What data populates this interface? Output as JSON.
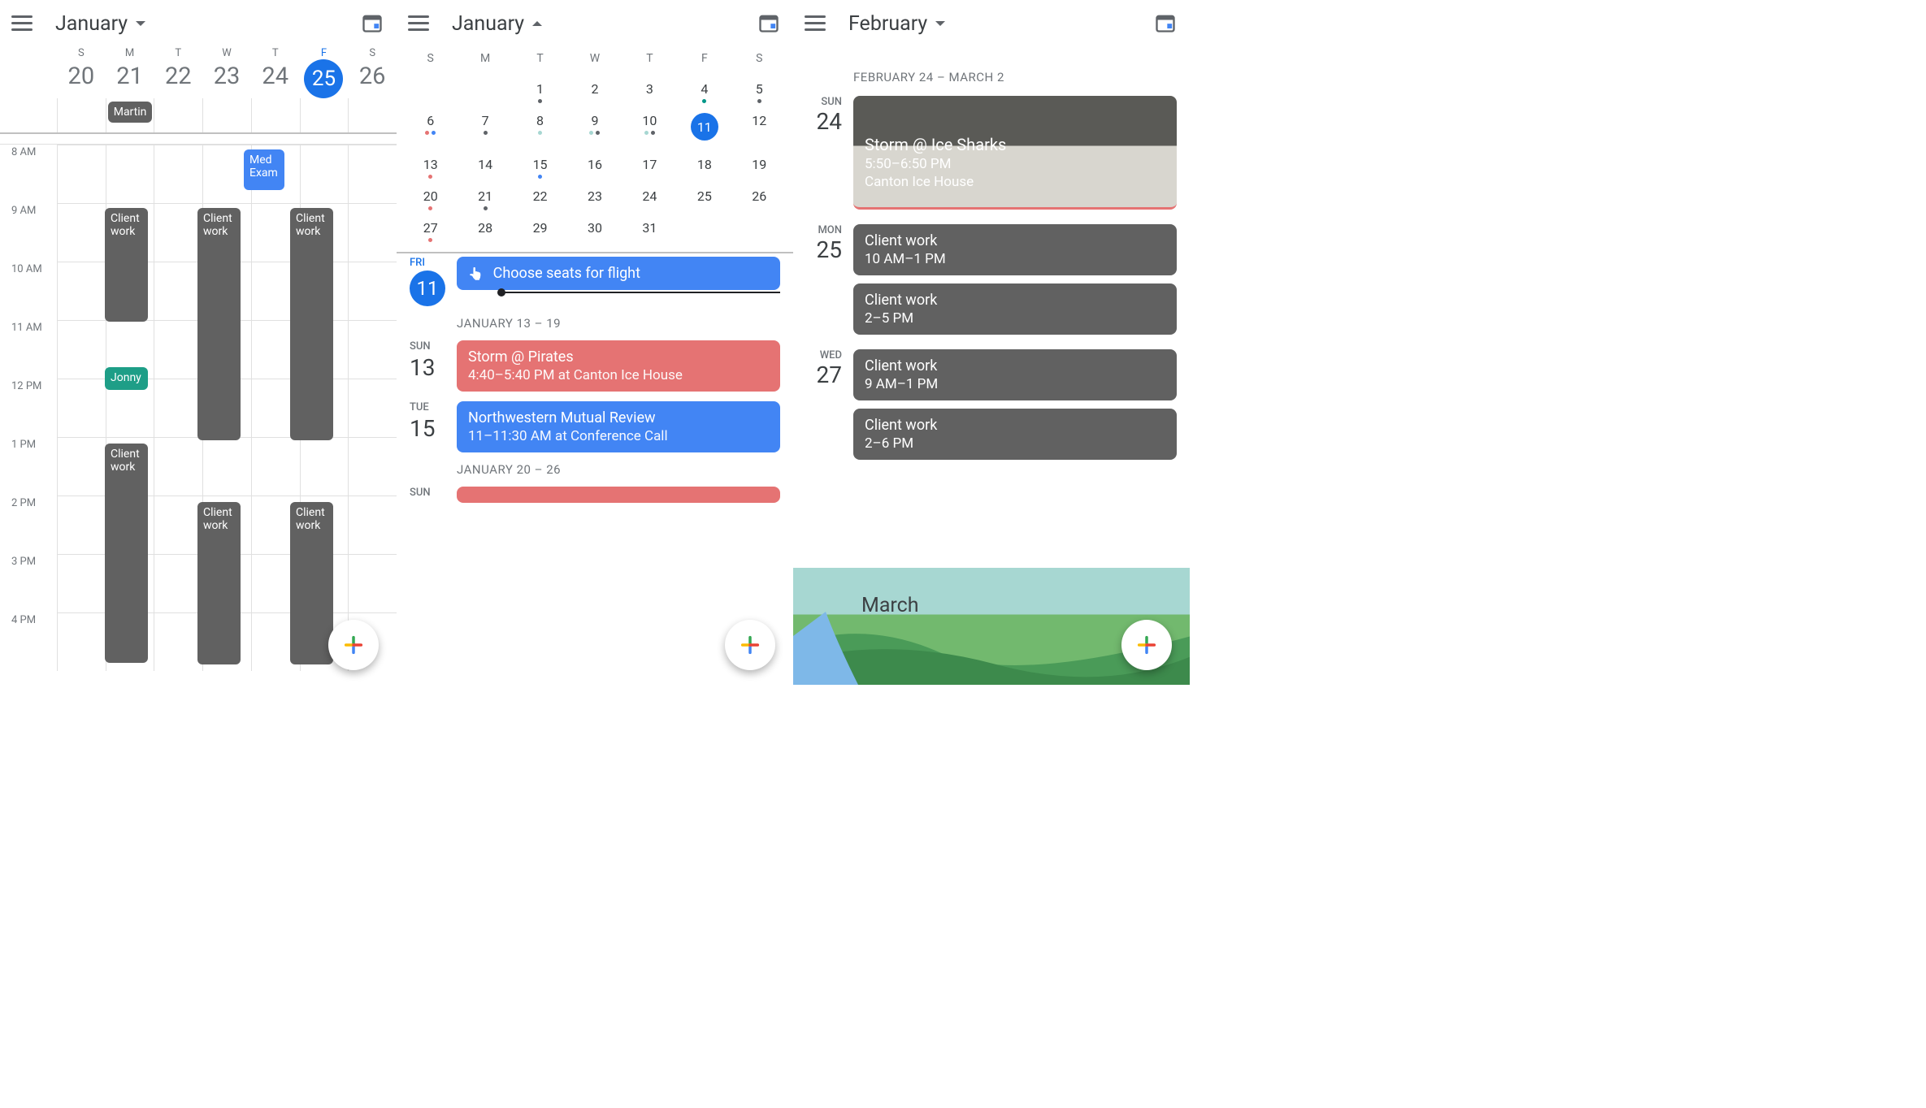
{
  "panel1": {
    "month": "January",
    "week": {
      "letters": [
        "S",
        "M",
        "T",
        "W",
        "T",
        "F",
        "S"
      ],
      "nums": [
        "20",
        "21",
        "22",
        "23",
        "24",
        "25",
        "26"
      ],
      "todayIndex": 5
    },
    "hours": [
      "8 AM",
      "9 AM",
      "10 AM",
      "11 AM",
      "12 PM",
      "1 PM",
      "2 PM",
      "3 PM",
      "4 PM"
    ],
    "allday_event": "Martin",
    "events": {
      "med": "Med Exam",
      "clientwork": "Client work",
      "jonny": "Jonny"
    }
  },
  "panel2": {
    "month": "January",
    "weekLetters": [
      "S",
      "M",
      "T",
      "W",
      "T",
      "F",
      "S"
    ],
    "grid": [
      [
        "",
        "",
        "1",
        "2",
        "3",
        "4",
        "5"
      ],
      [
        "6",
        "7",
        "8",
        "9",
        "10",
        "11",
        "12"
      ],
      [
        "13",
        "14",
        "15",
        "16",
        "17",
        "18",
        "19"
      ],
      [
        "20",
        "21",
        "22",
        "23",
        "24",
        "25",
        "26"
      ],
      [
        "27",
        "28",
        "29",
        "30",
        "31",
        "",
        ""
      ]
    ],
    "todayRow": 1,
    "todayCol": 5,
    "dots": {
      "0-2": [
        "#5f6368"
      ],
      "0-5": [
        "#009688"
      ],
      "0-6": [
        "#5f6368"
      ],
      "1-0": [
        "#e57373",
        "#4285f4"
      ],
      "1-1": [
        "#5f6368"
      ],
      "1-2": [
        "#a7d7d2"
      ],
      "1-3": [
        "#a7d7d2",
        "#5f6368"
      ],
      "1-4": [
        "#a7d7d2",
        "#5f6368"
      ],
      "2-0": [
        "#e57373"
      ],
      "2-2": [
        "#4285f4"
      ],
      "3-0": [
        "#e57373"
      ],
      "3-1": [
        "#5f6368"
      ],
      "4-0": [
        "#e57373"
      ]
    },
    "today_label_dow": "FRI",
    "today_label_num": "11",
    "today_event": "Choose seats for flight",
    "range1": "JANUARY 13 – 19",
    "day1_dow": "SUN",
    "day1_num": "13",
    "ev1_title": "Storm @ Pirates",
    "ev1_sub": "4:40–5:40 PM at Canton Ice House",
    "day2_dow": "TUE",
    "day2_num": "15",
    "ev2_title": "Northwestern Mutual Review",
    "ev2_sub": "11–11:30 AM at Conference Call",
    "range2": "JANUARY 20 – 26",
    "day3_dow": "SUN"
  },
  "panel3": {
    "month": "February",
    "range": "FEBRUARY 24 – MARCH 2",
    "days": [
      {
        "dow": "SUN",
        "num": "24",
        "image": true,
        "title": "Storm @ Ice Sharks",
        "sub1": "5:50–6:50 PM",
        "sub2": "Canton Ice House"
      },
      {
        "dow": "MON",
        "num": "25",
        "events": [
          {
            "title": "Client work",
            "sub": "10 AM–1 PM"
          },
          {
            "title": "Client work",
            "sub": "2–5 PM"
          }
        ]
      },
      {
        "dow": "WED",
        "num": "27",
        "events": [
          {
            "title": "Client work",
            "sub": "9 AM–1 PM"
          },
          {
            "title": "Client work",
            "sub": "2–6 PM"
          }
        ]
      }
    ],
    "march_label": "March"
  },
  "colors": {
    "gray": "#5f6368",
    "blue": "#4285f4",
    "teal": "#1e9e87",
    "coral": "#e57373",
    "dgray": "#616161"
  }
}
